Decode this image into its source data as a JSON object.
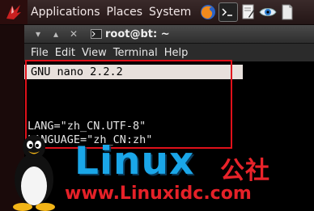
{
  "panel": {
    "menus": [
      "Applications",
      "Places",
      "System"
    ],
    "icons": [
      "firefox-icon",
      "terminal-icon",
      "text-editor-icon",
      "eye-icon",
      "document-icon"
    ]
  },
  "window": {
    "buttons": [
      "▾",
      "▴",
      "✕"
    ],
    "title": "root@bt: ~",
    "menus": [
      "File",
      "Edit",
      "View",
      "Terminal",
      "Help"
    ]
  },
  "terminal": {
    "nano_header": "GNU nano 2.2.2",
    "lines": [
      "LANG=\"zh_CN.UTF-8\"",
      "LANGUAGE=\"zh_CN:zh\""
    ]
  },
  "watermark": {
    "brand": "Linux",
    "brand_cn": "公社",
    "url": "www.Linuxidc.com"
  },
  "colors": {
    "highlight": "#e0101a",
    "brand_blue": "#1aa6e8",
    "brand_red": "#e52128"
  }
}
